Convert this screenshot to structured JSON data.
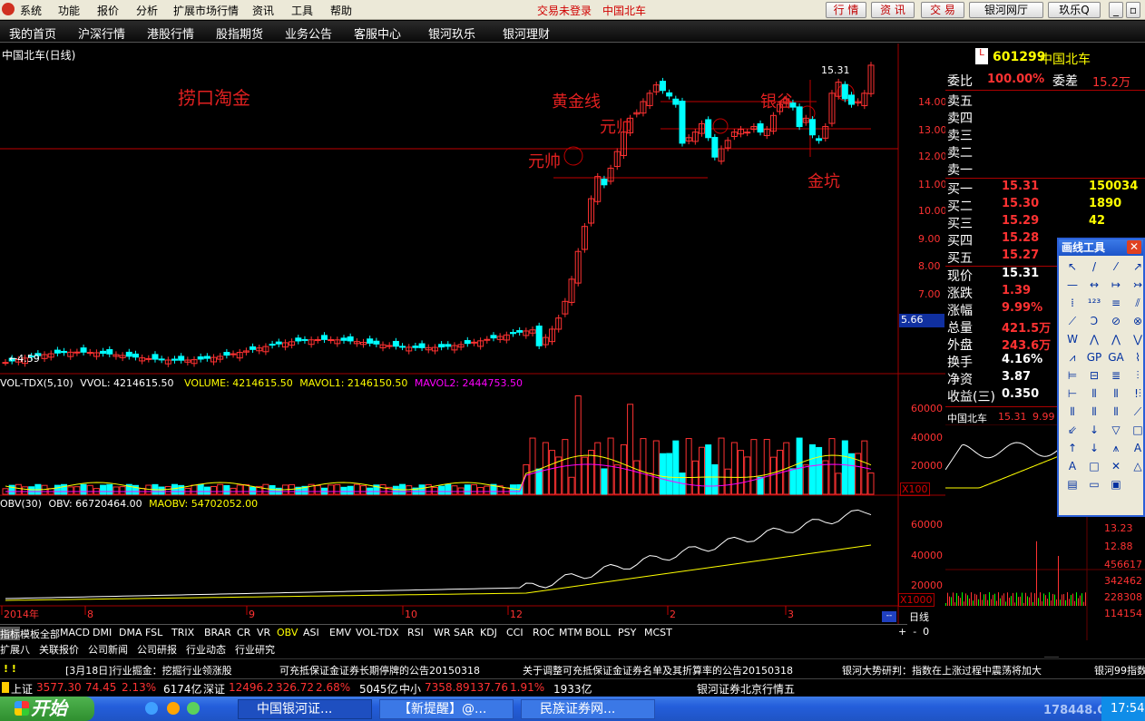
{
  "menu": {
    "items": [
      "系统",
      "功能",
      "报价",
      "分析",
      "扩展市场行情",
      "资讯",
      "工具",
      "帮助"
    ],
    "trade_status": "交易未登录",
    "stock_name": "中国北车",
    "right_buttons": [
      "行 情",
      "资 讯",
      "交 易",
      "银河网厅",
      "玖乐Q"
    ]
  },
  "nav": {
    "items": [
      "我的首页",
      "沪深行情",
      "港股行情",
      "股指期货",
      "业务公告",
      "客服中心",
      "银河玖乐",
      "银河理财"
    ]
  },
  "chart": {
    "title": "中国北车(日线)",
    "price_axis": [
      "14.00",
      "13.00",
      "12.00",
      "11.00",
      "10.00",
      "9.00",
      "8.00",
      "7.00",
      "6.00"
    ],
    "price_highlight": "5.66",
    "low_label": "4.59",
    "high_label": "15.31",
    "annotations": [
      "捞口淘金",
      "黄金线",
      "元帅",
      "元帅",
      "银谷",
      "金坑"
    ],
    "vol_legend": {
      "name": "VOL-TDX(5,10)",
      "vvol": "VVOL: 4214615.50",
      "volume": "VOLUME: 4214615.50",
      "mavol1": "MAVOL1: 2146150.50",
      "mavol2": "MAVOL2: 2444753.50"
    },
    "vol_axis": [
      "60000",
      "40000",
      "20000"
    ],
    "vol_unit": "X100",
    "obv_legend": {
      "name": "OBV(30)",
      "obv": "OBV: 66720464.00",
      "maobv": "MAOBV: 54702052.00"
    },
    "obv_axis": [
      "60000",
      "40000",
      "20000"
    ],
    "obv_unit": "X1000",
    "date_axis": [
      "2014年",
      "8",
      "9",
      "10",
      "12",
      "2",
      "3"
    ],
    "period": "日线"
  },
  "quote": {
    "code": "601299",
    "name": "中国北车",
    "weibi_label": "委比",
    "weibi": "100.00%",
    "weicha_label": "委差",
    "weicha": "15.2万",
    "sell": [
      {
        "label": "卖五"
      },
      {
        "label": "卖四"
      },
      {
        "label": "卖三"
      },
      {
        "label": "卖二"
      },
      {
        "label": "卖一"
      }
    ],
    "buy": [
      {
        "label": "买一",
        "price": "15.31",
        "vol": "150034"
      },
      {
        "label": "买二",
        "price": "15.30",
        "vol": "1890"
      },
      {
        "label": "买三",
        "price": "15.29",
        "vol": "42"
      },
      {
        "label": "买四",
        "price": "15.28",
        "vol": ""
      },
      {
        "label": "买五",
        "price": "15.27",
        "vol": ""
      }
    ],
    "stats": [
      {
        "label": "现价",
        "value": "15.31",
        "tail": "今"
      },
      {
        "label": "涨跌",
        "value": "1.39",
        "tail": "最"
      },
      {
        "label": "涨幅",
        "value": "9.99%",
        "tail": "最"
      },
      {
        "label": "总量",
        "value": "421.5万",
        "tail": "量"
      },
      {
        "label": "外盘",
        "value": "243.6万",
        "tail": "内"
      },
      {
        "label": "换手",
        "value": "4.16%",
        "tail": "股"
      },
      {
        "label": "净资",
        "value": "3.87",
        "tail": "流"
      },
      {
        "label": "收益(三)",
        "value": "0.350",
        "tail": "PE"
      }
    ],
    "mini_name": "中国北车",
    "mini_price": "15.31",
    "mini_pct": "9.99",
    "mini_axis": [
      "13.23",
      "12.88",
      "456617",
      "342462",
      "228308",
      "114154"
    ],
    "bottom_tabs": [
      "笔",
      "价",
      "细",
      "日",
      "势",
      "联",
      "值",
      "筹"
    ]
  },
  "draw_tools": {
    "title": "画线工具"
  },
  "indicator_tabs": [
    "指标",
    "模板",
    "全部",
    "MACD",
    "DMI",
    "DMA",
    "FSL",
    "TRIX",
    "BRAR",
    "CR",
    "VR",
    "OBV",
    "ASI",
    "EMV",
    "VOL-TDX",
    "RSI",
    "WR",
    "SAR",
    "KDJ",
    "CCI",
    "ROC",
    "MTM",
    "BOLL",
    "PSY",
    "MCST"
  ],
  "info_tabs": [
    "扩展八",
    "关联报价",
    "公司新闻",
    "公司研报",
    "行业动态",
    "行业研究"
  ],
  "news": [
    "[3月18日]行业掘金：挖掘行业领涨股",
    "可充抵保证金证券长期停牌的公告20150318",
    "关于调整可充抵保证金证券名单及其折算率的公告20150318",
    "银河大势研判：指数在上涨过程中震荡将加大",
    "银河99指数"
  ],
  "index_bar": [
    {
      "name": "上证",
      "val": "3577.30",
      "chg": "74.45",
      "pct": "2.13%",
      "amt": "6174亿"
    },
    {
      "name": "深证",
      "val": "12496.2",
      "chg": "326.72",
      "pct": "2.68%",
      "amt": "5045亿"
    },
    {
      "name": "中小",
      "val": "7358.89",
      "chg": "137.76",
      "pct": "1.91%",
      "amt": "1933亿"
    }
  ],
  "index_source": "银河证券北京行情五",
  "taskbar": {
    "start": "开始",
    "tasks": [
      "中国银河证...",
      "【新提醒】@...",
      "民族证券网..."
    ],
    "clock": "17:54",
    "watermark": "178448.COM"
  },
  "colors": {
    "up": "#ff3232",
    "down": "#00ffff",
    "ma1": "#ffffff",
    "ma2": "#ffff00",
    "ma3": "#ff00ff"
  }
}
